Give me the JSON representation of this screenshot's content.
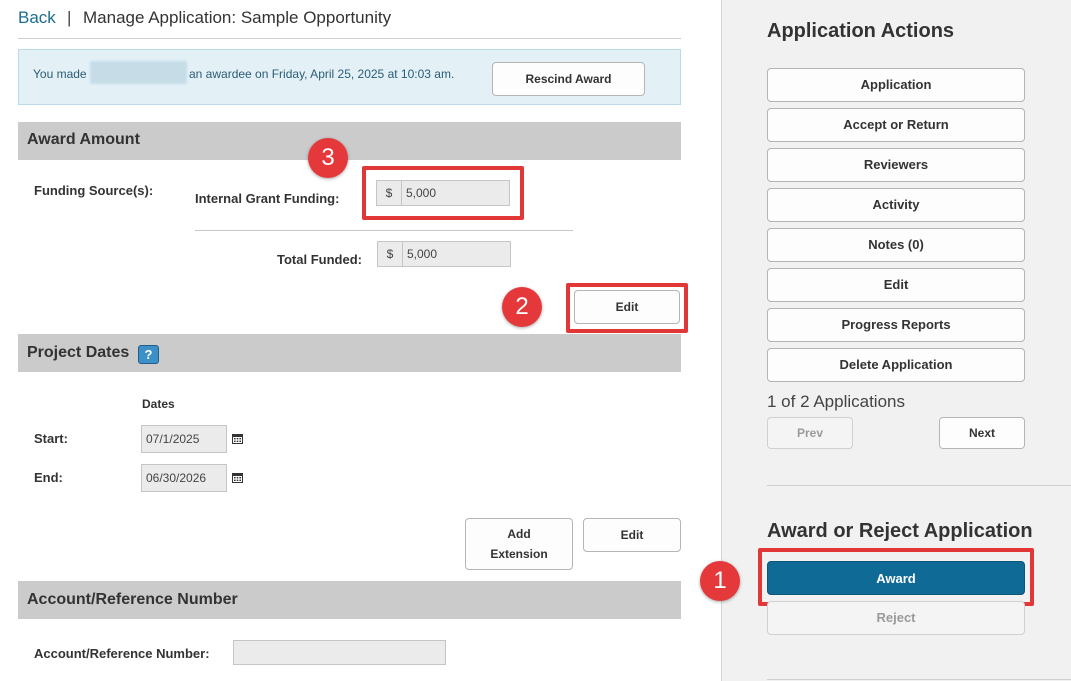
{
  "header": {
    "back_label": "Back",
    "separator": "|",
    "title": "Manage Application: Sample Opportunity"
  },
  "notice": {
    "prefix": "You made",
    "suffix": "an awardee on Friday, April 25, 2025 at 10:03 am.",
    "rescind_label": "Rescind Award"
  },
  "award_amount": {
    "section_title": "Award Amount",
    "funding_sources_label": "Funding Source(s):",
    "internal_grant_label": "Internal Grant Funding:",
    "internal_grant_currency": "$",
    "internal_grant_value": "5,000",
    "total_funded_label": "Total Funded:",
    "total_funded_currency": "$",
    "total_funded_value": "5,000",
    "edit_label": "Edit"
  },
  "project_dates": {
    "section_title": "Project Dates",
    "help_label": "?",
    "dates_header": "Dates",
    "start_label": "Start:",
    "start_value": "07/1/2025",
    "end_label": "End:",
    "end_value": "06/30/2026",
    "add_extension_label_1": "Add",
    "add_extension_label_2": "Extension",
    "edit_label": "Edit"
  },
  "account_reference": {
    "section_title": "Account/Reference Number",
    "field_label": "Account/Reference Number:",
    "field_value": ""
  },
  "application_actions": {
    "title": "Application Actions",
    "buttons": [
      "Application",
      "Accept or Return",
      "Reviewers",
      "Activity",
      "Notes (0)",
      "Edit",
      "Progress Reports",
      "Delete Application"
    ],
    "pager_text": "1 of 2 Applications",
    "prev_label": "Prev",
    "next_label": "Next"
  },
  "award_or_reject": {
    "title": "Award or Reject Application",
    "award_label": "Award",
    "reject_label": "Reject"
  },
  "annotations": {
    "step_1": "1",
    "step_2": "2",
    "step_3": "3",
    "highlight_color": "#e13737"
  },
  "colors": {
    "link": "#1a6e8e",
    "notice_bg": "#e3f1f7",
    "section_header_bg": "#cbcbcb",
    "award_button_bg": "#0f6a96",
    "panel_bg": "#f1f1f1"
  }
}
